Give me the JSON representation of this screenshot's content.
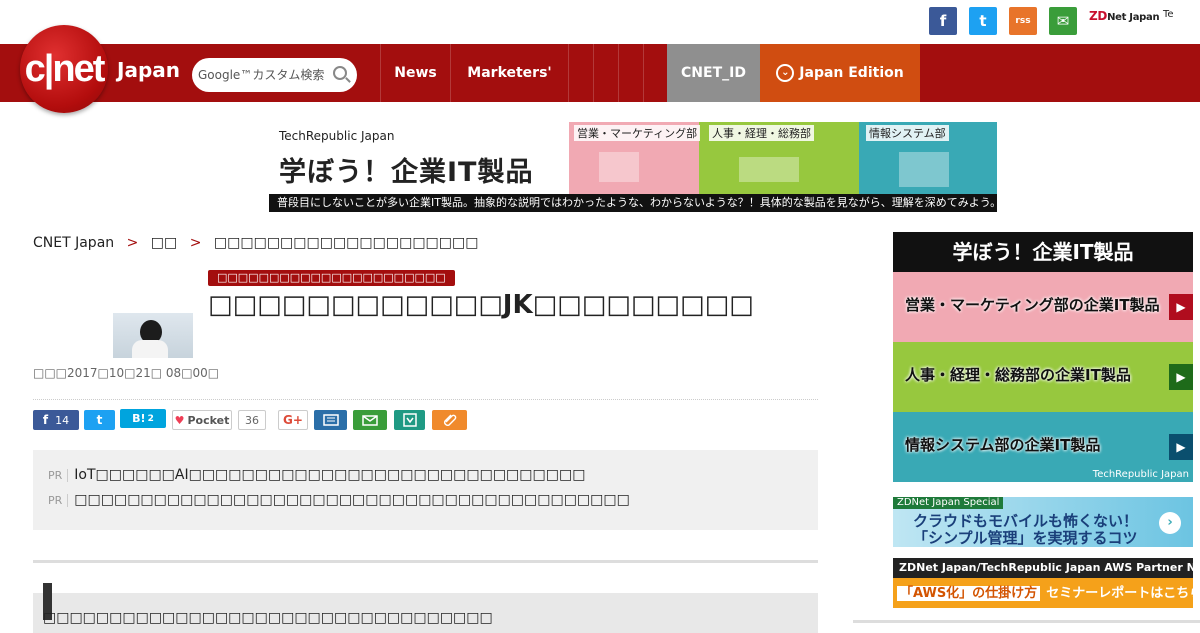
{
  "top": {
    "social": {
      "facebook": "f",
      "twitter": "t",
      "rss": "rss",
      "mail": "✉"
    },
    "zdnet_label": "ZD",
    "zdnet_text": "Net Japan",
    "techrepublic_text": "Te"
  },
  "header": {
    "logo_text": "c|net",
    "logo_sub": "Japan",
    "search_placeholder": "Google™カスタム検索",
    "nav": [
      "News",
      "Marketers'",
      "",
      "",
      "",
      ""
    ],
    "cnet_id": "CNET_ID",
    "edition": "Japan Edition",
    "colors": {
      "header": "#a30e0e",
      "cnet_id": "#8f8f8f",
      "edition": "#d04d11"
    }
  },
  "banner": {
    "brand": "TechRepublic Japan",
    "headline": "学ぼう！企業IT製品",
    "tags": [
      "営業・マーケティング部",
      "人事・経理・総務部",
      "情報システム部"
    ],
    "footer": "普段目にしないことが多い企業IT製品。抽象的な説明ではわかったような、わからないような？！具体的な製品を見ながら、理解を深めてみよう。"
  },
  "breadcrumb": {
    "root": "CNET Japan",
    "sep1": ">",
    "level1": "□□",
    "sep2": ">",
    "level2": "□□□□□□□□□□□□□□□□□□□□"
  },
  "article": {
    "category_tag": "□□□□□□□□□□□□□□□□□□□□□□",
    "title": "□□□□□□□□□□□□JK□□□□□□□□□",
    "byline": "□□□2017□10□21□ 08□00□"
  },
  "share": {
    "facebook_count": "14",
    "hatena_label": "B!",
    "hatena_count": "2",
    "pocket_label": "Pocket",
    "pocket_count": "36",
    "gplus_label": "G+"
  },
  "pr": {
    "label": "PR",
    "items": [
      "IoT□□□□□□AI□□□□□□□□□□□□□□□□□□□□□□□□□□□□□□",
      "□□□□□□□□□□□□□□□□□□□□□□□□□□□□□□□□□□□□□□□□□□"
    ]
  },
  "lead": {
    "text": "□□□□□□□□□□□□□□□□□□□□□□□□□□□□□□□□□□"
  },
  "sidebar": {
    "ad1": {
      "heading": "学ぼう！企業IT製品",
      "rows": [
        "営業・マーケティング部の企業IT製品",
        "人事・経理・総務部の企業IT製品",
        "情報システム部の企業IT製品"
      ],
      "footer": "TechRepublic Japan"
    },
    "ad2": {
      "label": "ZDNet Japan Special",
      "line1": "クラウドもモバイルも怖くない！",
      "line2": "「シンプル管理」を実現するコツ"
    },
    "ad3": {
      "top": "ZDNet Japan/TechRepublic Japan  AWS Partner Network",
      "tag": "「AWS化」の仕掛け方",
      "text": "セミナーレポートはこちら"
    }
  }
}
